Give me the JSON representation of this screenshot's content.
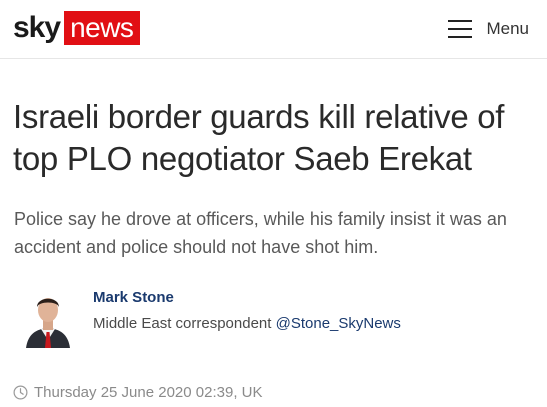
{
  "header": {
    "logo_sky": "sky",
    "logo_news": "news",
    "menu_label": "Menu"
  },
  "article": {
    "headline": "Israeli border guards kill relative of top PLO negotiator Saeb Erekat",
    "standfirst": "Police say he drove at officers, while his family insist it was an accident and police should not have shot him.",
    "author": {
      "name": "Mark Stone",
      "role": "Middle East correspondent",
      "handle": "@Stone_SkyNews"
    },
    "timestamp": "Thursday 25 June 2020 02:39, UK"
  },
  "colors": {
    "brand_red": "#e10f14",
    "link_blue": "#1a3a6e",
    "muted_gray": "#8a8a8a"
  },
  "icons": [
    "hamburger-menu-icon",
    "clock-icon"
  ]
}
